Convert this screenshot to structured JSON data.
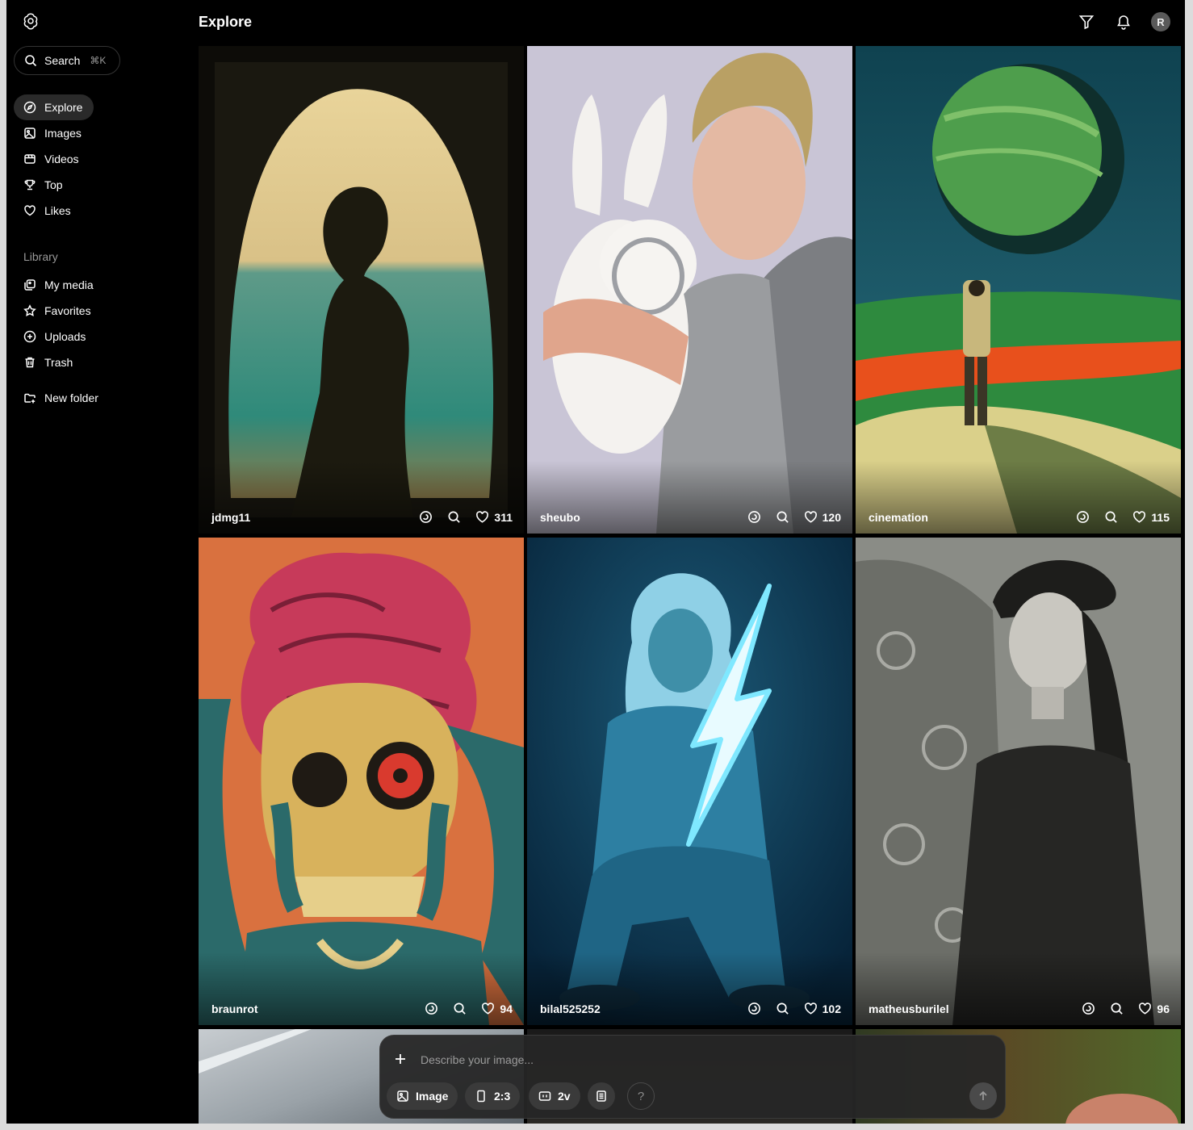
{
  "app": {
    "title": "Explore"
  },
  "search": {
    "label": "Search",
    "shortcut": "⌘K"
  },
  "nav": [
    {
      "label": "Explore",
      "icon": "compass-icon",
      "active": true
    },
    {
      "label": "Images",
      "icon": "image-icon"
    },
    {
      "label": "Videos",
      "icon": "video-icon"
    },
    {
      "label": "Top",
      "icon": "trophy-icon"
    },
    {
      "label": "Likes",
      "icon": "heart-icon"
    }
  ],
  "library": {
    "heading": "Library",
    "items": [
      {
        "label": "My media",
        "icon": "media-icon"
      },
      {
        "label": "Favorites",
        "icon": "star-icon"
      },
      {
        "label": "Uploads",
        "icon": "upload-icon"
      },
      {
        "label": "Trash",
        "icon": "trash-icon"
      }
    ],
    "new_folder": "New folder"
  },
  "header": {
    "avatar_initial": "R"
  },
  "cards": [
    {
      "user": "jdmg11",
      "likes": "311"
    },
    {
      "user": "sheubo",
      "likes": "120"
    },
    {
      "user": "cinemation",
      "likes": "115"
    },
    {
      "user": "braunrot",
      "likes": "94"
    },
    {
      "user": "bilal525252",
      "likes": "102"
    },
    {
      "user": "matheusburilel",
      "likes": "96"
    }
  ],
  "composer": {
    "placeholder": "Describe your image...",
    "type_label": "Image",
    "ratio_label": "2:3",
    "variants_label": "2v",
    "help_label": "?"
  },
  "colors": {
    "background": "#000000",
    "pill": "#3a3a3a",
    "active_nav": "#2a2a2a"
  }
}
